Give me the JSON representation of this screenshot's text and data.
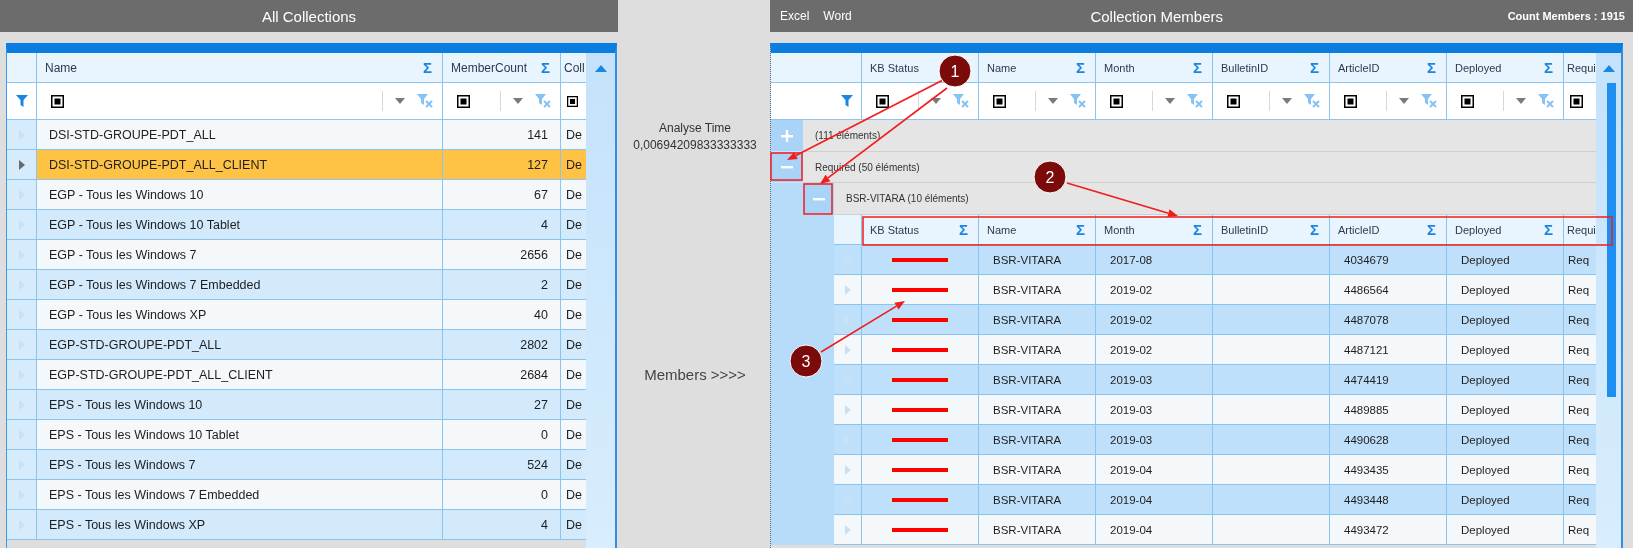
{
  "left_panel": {
    "title": "All Collections",
    "columns": [
      {
        "label": "Name",
        "aggregate": "Σ",
        "kind": "full"
      },
      {
        "label": "MemberCount",
        "aggregate": "Σ",
        "kind": "full"
      },
      {
        "label": "Coll",
        "kind": "checkbox"
      }
    ],
    "rows": [
      {
        "name": "DSI-STD-GROUPE-PDT_ALL",
        "member_count": "141",
        "column_3": "De",
        "selected": false
      },
      {
        "name": "DSI-STD-GROUPE-PDT_ALL_CLIENT",
        "member_count": "127",
        "column_3": "De",
        "selected": true
      },
      {
        "name": "EGP - Tous les Windows 10",
        "member_count": "67",
        "column_3": "De",
        "selected": false
      },
      {
        "name": "EGP - Tous les Windows 10 Tablet",
        "member_count": "4",
        "column_3": "De",
        "selected": false
      },
      {
        "name": "EGP - Tous les Windows 7",
        "member_count": "2656",
        "column_3": "De",
        "selected": false
      },
      {
        "name": "EGP - Tous les Windows 7 Embedded",
        "member_count": "2",
        "column_3": "De",
        "selected": false
      },
      {
        "name": "EGP - Tous les Windows XP",
        "member_count": "40",
        "column_3": "De",
        "selected": false
      },
      {
        "name": "EGP-STD-GROUPE-PDT_ALL",
        "member_count": "2802",
        "column_3": "De",
        "selected": false
      },
      {
        "name": "EGP-STD-GROUPE-PDT_ALL_CLIENT",
        "member_count": "2684",
        "column_3": "De",
        "selected": false
      },
      {
        "name": "EPS - Tous les Windows 10",
        "member_count": "27",
        "column_3": "De",
        "selected": false
      },
      {
        "name": "EPS - Tous les Windows 10 Tablet",
        "member_count": "0",
        "column_3": "De",
        "selected": false
      },
      {
        "name": "EPS - Tous les Windows 7",
        "member_count": "524",
        "column_3": "De",
        "selected": false
      },
      {
        "name": "EPS - Tous les Windows 7 Embedded",
        "member_count": "0",
        "column_3": "De",
        "selected": false
      },
      {
        "name": "EPS - Tous les Windows XP",
        "member_count": "4",
        "column_3": "De",
        "selected": false
      }
    ]
  },
  "middle_panel": {
    "analyse_label": "Analyse Time",
    "analyse_value": "0,00694209833333333",
    "members_button": "Members >>>>"
  },
  "right_panel": {
    "menu": [
      "Excel",
      "Word"
    ],
    "title": "Collection Members",
    "count": "Count Members : 1915",
    "columns": [
      {
        "label": "KB Status",
        "kind": "full"
      },
      {
        "label": "Name",
        "aggregate": "Σ",
        "kind": "full"
      },
      {
        "label": "Month",
        "aggregate": "Σ",
        "kind": "full"
      },
      {
        "label": "BulletinID",
        "aggregate": "Σ",
        "kind": "full"
      },
      {
        "label": "ArticleID",
        "aggregate": "Σ",
        "kind": "full"
      },
      {
        "label": "Deployed",
        "aggregate": "Σ",
        "kind": "full"
      },
      {
        "label": "Requi",
        "kind": "checkbox"
      }
    ],
    "groups": [
      {
        "label": "(111 éléments)",
        "expanded": false
      },
      {
        "label": "Required (50 éléments)",
        "expanded": true,
        "children": [
          {
            "label": "BSR-VITARA (10 éléments)",
            "expanded": true,
            "columns": [
              {
                "label": "KB Status",
                "aggregate": "Σ"
              },
              {
                "label": "Name",
                "aggregate": "Σ"
              },
              {
                "label": "Month",
                "aggregate": "Σ"
              },
              {
                "label": "BulletinID",
                "aggregate": "Σ"
              },
              {
                "label": "ArticleID",
                "aggregate": "Σ"
              },
              {
                "label": "Deployed",
                "aggregate": "Σ"
              },
              {
                "label": "Requi"
              }
            ],
            "rows": [
              {
                "color": "#ff0000",
                "name": "BSR-VITARA",
                "month": "2017-08",
                "article_id": "4034679",
                "deployed": "Deployed",
                "column_7": "Req"
              },
              {
                "color": "#ff0000",
                "name": "BSR-VITARA",
                "month": "2019-02",
                "article_id": "4486564",
                "deployed": "Deployed",
                "column_7": "Req"
              },
              {
                "color": "#ff0000",
                "name": "BSR-VITARA",
                "month": "2019-02",
                "article_id": "4487078",
                "deployed": "Deployed",
                "column_7": "Req"
              },
              {
                "color": "#ff0000",
                "name": "BSR-VITARA",
                "month": "2019-02",
                "article_id": "4487121",
                "deployed": "Deployed",
                "column_7": "Req"
              },
              {
                "color": "#ff0000",
                "name": "BSR-VITARA",
                "month": "2019-03",
                "article_id": "4474419",
                "deployed": "Deployed",
                "column_7": "Req"
              },
              {
                "color": "#ff0000",
                "name": "BSR-VITARA",
                "month": "2019-03",
                "article_id": "4489885",
                "deployed": "Deployed",
                "column_7": "Req"
              },
              {
                "color": "#ff0000",
                "name": "BSR-VITARA",
                "month": "2019-03",
                "article_id": "4490628",
                "deployed": "Deployed",
                "column_7": "Req"
              },
              {
                "color": "#ff0000",
                "name": "BSR-VITARA",
                "month": "2019-04",
                "article_id": "4493435",
                "deployed": "Deployed",
                "column_7": "Req"
              },
              {
                "color": "#ff0000",
                "name": "BSR-VITARA",
                "month": "2019-04",
                "article_id": "4493448",
                "deployed": "Deployed",
                "column_7": "Req"
              },
              {
                "color": "#ff0000",
                "name": "BSR-VITARA",
                "month": "2019-04",
                "article_id": "4493472",
                "deployed": "Deployed",
                "column_7": "Req"
              }
            ]
          }
        ]
      }
    ]
  },
  "annotations": [
    {
      "label": "1"
    },
    {
      "label": "2"
    },
    {
      "label": "3"
    }
  ]
}
